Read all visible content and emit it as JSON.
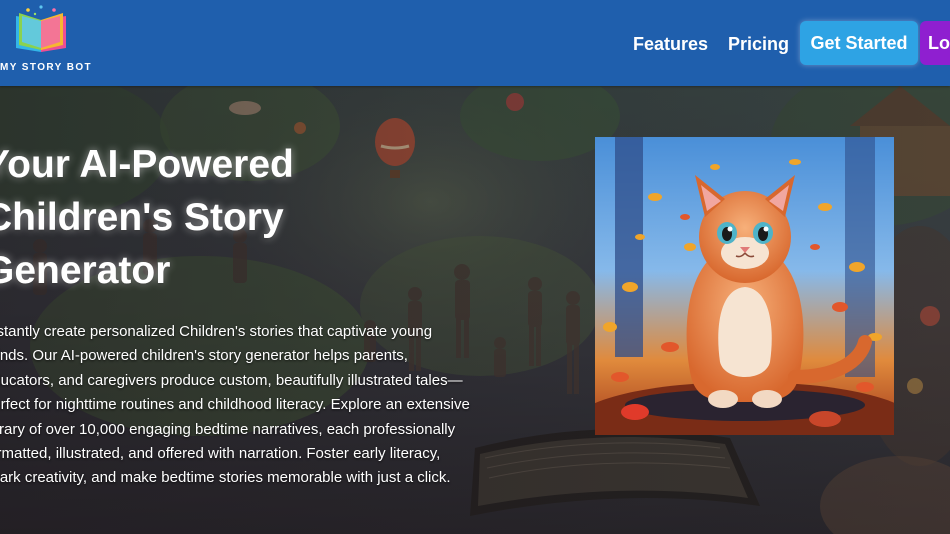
{
  "brand": {
    "logo_text": "MY STORY BOT",
    "logo_icon": "open-book-icon"
  },
  "nav": {
    "features": "Features",
    "pricing": "Pricing",
    "get_started": "Get Started",
    "login": "Login"
  },
  "hero": {
    "title": "Your AI-Powered Children's Story Generator",
    "description": "Instantly create personalized Children's stories that captivate young minds. Our AI-powered children's story generator helps parents, educators, and caregivers produce custom, beautifully illustrated tales—perfect for nighttime routines and childhood literacy. Explore an extensive library of over 10,000 engaging bedtime narratives, each professionally formatted, illustrated, and offered with narration. Foster early literacy, spark creativity, and make bedtime stories memorable with just a click.",
    "image_subject": "orange-kitten-autumn-leaves"
  },
  "colors": {
    "navbar": "#1f5fad",
    "get_started_button": "#2ea3e4",
    "login_button": "#8f1fd0"
  }
}
